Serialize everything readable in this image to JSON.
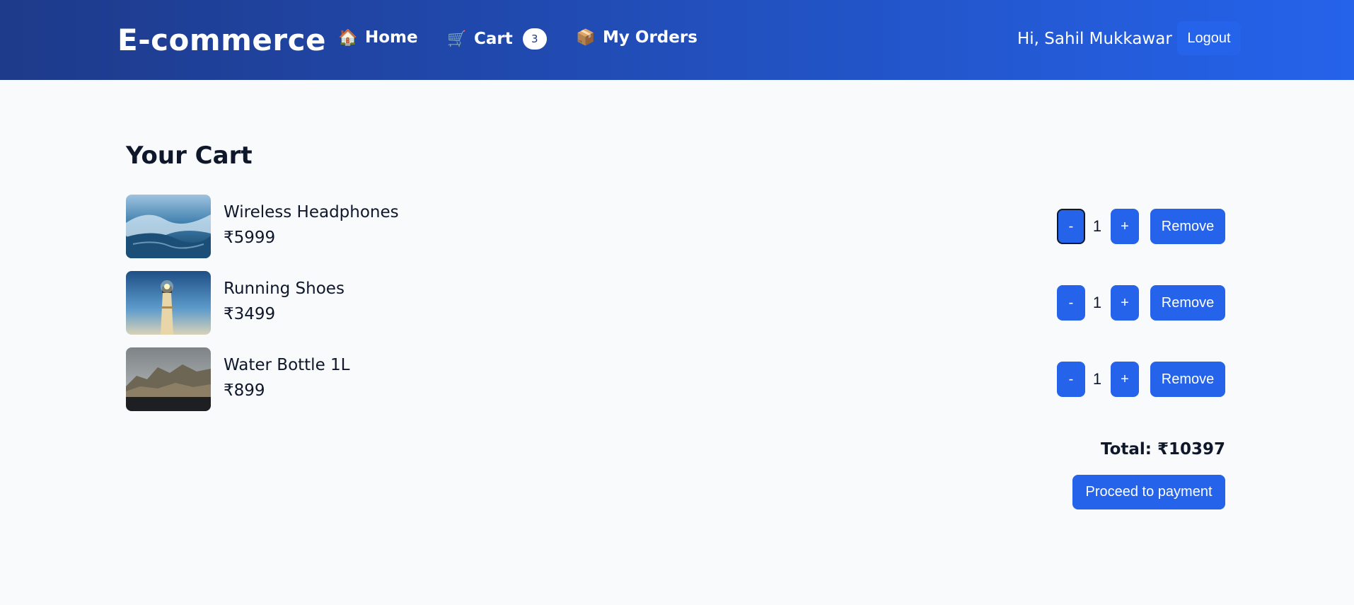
{
  "header": {
    "brand": "E-commerce",
    "nav": {
      "home": {
        "icon": "house-icon",
        "glyph": "🏠",
        "label": "Home"
      },
      "cart": {
        "icon": "cart-icon",
        "glyph": "🛒",
        "label": "Cart",
        "badge": "3"
      },
      "orders": {
        "icon": "package-icon",
        "glyph": "📦",
        "label": "My Orders"
      }
    },
    "greeting": "Hi, Sahil Mukkawar",
    "logout_label": "Logout"
  },
  "cart": {
    "title": "Your Cart",
    "items": [
      {
        "name": "Wireless Headphones",
        "price": "₹5999",
        "quantity": "1",
        "image": "ocean-wave-photo"
      },
      {
        "name": "Running Shoes",
        "price": "₹3499",
        "quantity": "1",
        "image": "lighthouse-photo"
      },
      {
        "name": "Water Bottle 1L",
        "price": "₹899",
        "quantity": "1",
        "image": "coastal-cliff-photo"
      }
    ],
    "controls": {
      "decrement_label": "-",
      "increment_label": "+",
      "remove_label": "Remove"
    },
    "total": "Total: ₹10397",
    "checkout_label": "Proceed to payment"
  },
  "colors": {
    "header_gradient_start": "#1e3a8a",
    "header_gradient_end": "#2563eb",
    "button": "#2563eb",
    "background": "#f8fafc",
    "text": "#0f172a"
  }
}
